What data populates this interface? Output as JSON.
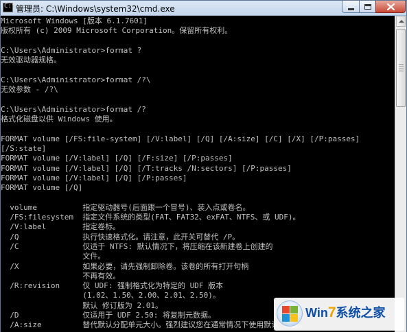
{
  "window": {
    "title": "管理员: C:\\Windows\\system32\\cmd.exe",
    "icon": "cmd-icon"
  },
  "console": {
    "lines": [
      "Microsoft Windows [版本 6.1.7601]",
      "版权所有 (c) 2009 Microsoft Corporation。保留所有权利。",
      "",
      "C:\\Users\\Administrator>format ?",
      "无效驱动器规格。",
      "",
      "C:\\Users\\Administrator>format /?\\",
      "无效参数 - /?\\",
      "",
      "C:\\Users\\Administrator>format /?",
      "格式化磁盘以供 Windows 使用。",
      "",
      "FORMAT volume [/FS:file-system] [/V:label] [/Q] [/A:size] [/C] [/X] [/P:passes]",
      "[/S:state]",
      "FORMAT volume [/V:label] [/Q] [/F:size] [/P:passes]",
      "FORMAT volume [/V:label] [/Q] [/T:tracks /N:sectors] [/P:passes]",
      "FORMAT volume [/V:label] [/Q] [/P:passes]",
      "FORMAT volume [/Q]",
      "",
      "  volume          指定驱动器号(后面跟一个冒号)、装入点或卷名。",
      "  /FS:filesystem  指定文件系统的类型(FAT、FAT32、exFAT、NTFS、或 UDF)。",
      "  /V:label        指定卷标。",
      "  /Q              执行快速格式化。请注意，此开关可替代 /P。",
      "  /C              仅适于 NTFS: 默认情况下，将压缩在该新建卷上创建的",
      "                  文件。",
      "  /X              如果必要，请先强制卸除卷。该卷的所有打开句柄",
      "                  不再有效。",
      "  /R:revision     仅 UDF: 强制格式化为特定的 UDF 版本",
      "                  (1.02、1.50、2.00、2.01、2.50)。",
      "                  默认 修订版为 2.01。",
      "  /D              仅适用于 UDF 2.50: 将复制元数据。",
      "  /A:size         替代默认分配单元大小。强烈建议您在通常情况下使用默认 设置。"
    ]
  },
  "watermark": {
    "brand_w": "Win",
    "brand_7": "7",
    "brand_cn": "系统之家",
    "colors": {
      "blue": "#0e4ea6",
      "orange": "#f0a400"
    }
  },
  "colors": {
    "console_bg": "#000000",
    "console_fg": "#c0c0c0",
    "titlebar": "#c4d6ec",
    "close_button": "#c74a36"
  }
}
